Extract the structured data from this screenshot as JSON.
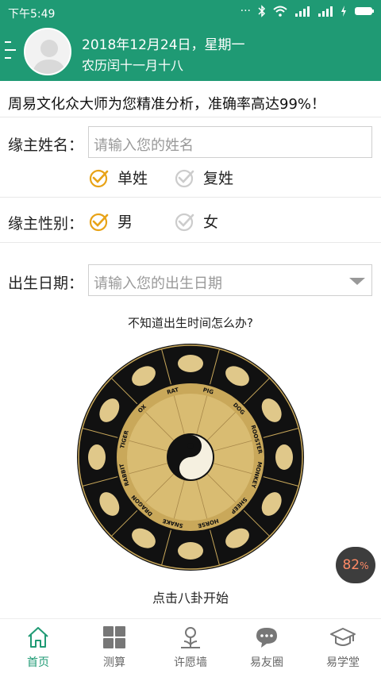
{
  "status_bar": {
    "time": "下午5:49",
    "icons": [
      "dots-icon",
      "bluetooth-icon",
      "wifi-icon",
      "signal-icon",
      "signal-icon",
      "charging-icon",
      "battery-icon"
    ]
  },
  "header": {
    "date": "2018年12月24日，星期一",
    "lunar": "农历闰十一月十八"
  },
  "slogan": "周易文化众大师为您精准分析，准确率高达99%！",
  "form": {
    "name_label": "缘主姓名：",
    "name_placeholder": "请输入您的姓名",
    "single_surname": "单姓",
    "compound_surname": "复姓",
    "gender_label": "缘主性别：",
    "male": "男",
    "female": "女",
    "birth_label": "出生日期：",
    "birth_placeholder": "请输入您的出生日期"
  },
  "hint": "不知道出生时间怎么办?",
  "start_text": "点击八卦开始",
  "badge": {
    "value": "82",
    "unit": "%"
  },
  "zodiac_labels": [
    "RAT",
    "PIG",
    "DOG",
    "ROOSTER",
    "MONKEY",
    "SHEEP",
    "HORSE",
    "SNAKE",
    "DRAGON",
    "RABBIT",
    "TIGER",
    "OX"
  ],
  "tabs": [
    {
      "label": "首页",
      "icon": "home-icon",
      "active": true
    },
    {
      "label": "测算",
      "icon": "grid-icon",
      "active": false
    },
    {
      "label": "许愿墙",
      "icon": "flower-icon",
      "active": false
    },
    {
      "label": "易友圈",
      "icon": "chat-icon",
      "active": false
    },
    {
      "label": "易学堂",
      "icon": "graduation-cap-icon",
      "active": false
    }
  ],
  "colors": {
    "primary": "#1f9a74",
    "check": "#e8a317",
    "check_off": "#cccccc"
  }
}
